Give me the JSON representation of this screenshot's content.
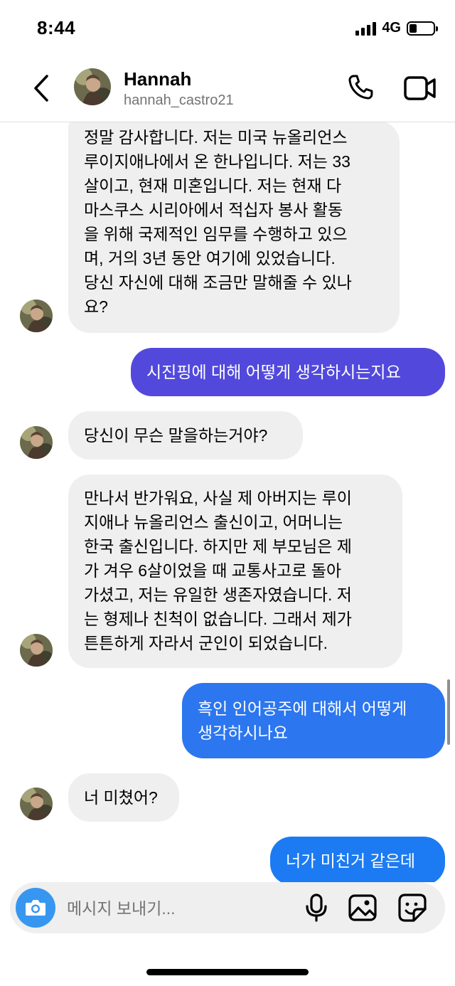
{
  "status_bar": {
    "time": "8:44",
    "network": "4G",
    "battery_level": 0.3
  },
  "header": {
    "name": "Hannah",
    "username": "hannah_castro21"
  },
  "colors": {
    "outgoing_gradient_top": "#5b51d8",
    "outgoing_mid": "#3d6fe8",
    "outgoing_bottom": "#1c7bf2",
    "incoming_bg": "#efefef",
    "accent": "#3797f0"
  },
  "messages": [
    {
      "direction": "incoming",
      "lines": [
        "정말 감사합니다. 저는 미국 뉴올리언스",
        "루이지애나에서 온 한나입니다. 저는 33",
        "살이고, 현재 미혼입니다. 저는 현재 다",
        "마스쿠스 시리아에서 적십자 봉사 활동",
        "을 위해 국제적인 임무를 수행하고 있으",
        "며, 거의 3년 동안 여기에 있었습니다.",
        "당신 자신에 대해 조금만 말해줄 수 있나",
        "요?"
      ]
    },
    {
      "direction": "outgoing",
      "lines": [
        "시진핑에 대해 어떻게 생각하시는지요"
      ]
    },
    {
      "direction": "incoming",
      "lines": [
        "당신이 무슨 말을하는거야?"
      ]
    },
    {
      "direction": "incoming",
      "lines": [
        "만나서 반가워요, 사실 제 아버지는 루이",
        "지애나 뉴올리언스 출신이고, 어머니는",
        "한국 출신입니다. 하지만 제 부모님은 제",
        "가 겨우 6살이었을 때 교통사고로 돌아",
        "가셨고, 저는 유일한 생존자였습니다. 저",
        "는 형제나 친척이 없습니다. 그래서 제가",
        "튼튼하게 자라서 군인이 되었습니다."
      ]
    },
    {
      "direction": "outgoing",
      "lines": [
        "흑인 인어공주에 대해서 어떻게",
        "생각하시나요"
      ]
    },
    {
      "direction": "incoming",
      "lines": [
        "너 미쳤어?"
      ]
    },
    {
      "direction": "outgoing",
      "lines": [
        "너가 미친거 같은데"
      ]
    }
  ],
  "composer": {
    "placeholder": "메시지 보내기..."
  },
  "icons": {
    "back": "chevron-left-icon",
    "call": "phone-icon",
    "video": "video-camera-icon",
    "camera": "camera-icon",
    "mic": "microphone-icon",
    "gallery": "image-icon",
    "sticker": "sticker-icon"
  }
}
